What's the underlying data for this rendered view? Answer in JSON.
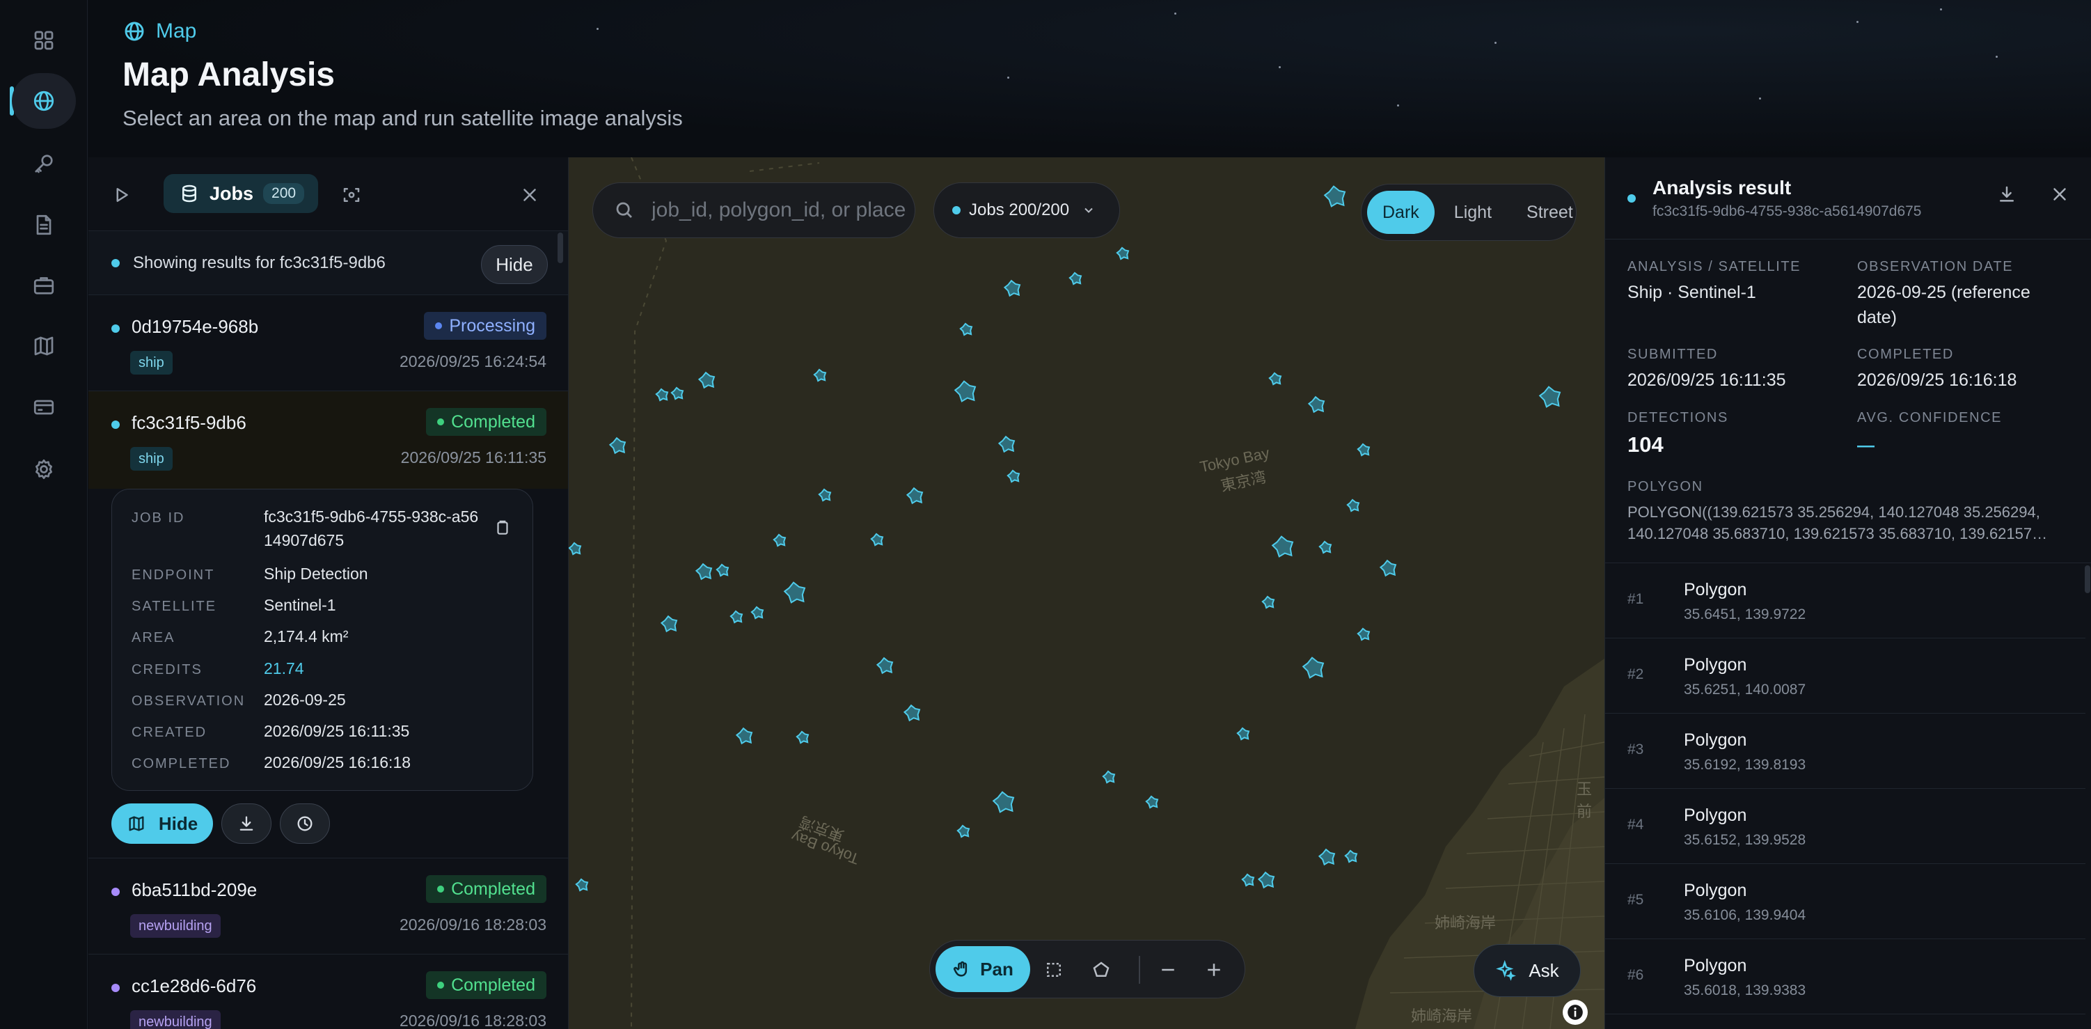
{
  "header": {
    "breadcrumb": "Map",
    "title": "Map Analysis",
    "subtitle": "Select an area on the map and run satellite image analysis"
  },
  "sidebar": {
    "items": [
      {
        "icon": "grid-icon",
        "active": false
      },
      {
        "icon": "globe-icon",
        "active": true
      },
      {
        "icon": "key-icon",
        "active": false
      },
      {
        "icon": "document-icon",
        "active": false
      },
      {
        "icon": "briefcase-icon",
        "active": false
      },
      {
        "icon": "map-icon",
        "active": false
      },
      {
        "icon": "credit-card-icon",
        "active": false
      },
      {
        "icon": "gear-icon",
        "active": false
      }
    ]
  },
  "jobs_panel": {
    "tab_label": "Jobs",
    "tab_count": "200",
    "showing_text": "Showing results for fc3c31f5-9db6",
    "hide_label": "Hide",
    "jobs": [
      {
        "id": "0d19754e-968b",
        "tag": "ship",
        "status": "Processing",
        "date": "2026/09/25 16:24:54"
      },
      {
        "id": "fc3c31f5-9db6",
        "tag": "ship",
        "status": "Completed",
        "date": "2026/09/25 16:11:35"
      },
      {
        "id": "6ba511bd-209e",
        "tag": "newbuilding",
        "status": "Completed",
        "date": "2026/09/16 18:28:03"
      },
      {
        "id": "cc1e28d6-6d76",
        "tag": "newbuilding",
        "status": "Completed",
        "date": "2026/09/16 18:28:03"
      }
    ],
    "detail": {
      "job_id_label": "JOB ID",
      "job_id": "fc3c31f5-9db6-4755-938c-a5614907d675",
      "endpoint_label": "ENDPOINT",
      "endpoint": "Ship Detection",
      "satellite_label": "SATELLITE",
      "satellite": "Sentinel-1",
      "area_label": "AREA",
      "area": "2,174.4 km²",
      "credits_label": "CREDITS",
      "credits": "21.74",
      "observation_label": "OBSERVATION",
      "observation": "2026-09-25",
      "created_label": "CREATED",
      "created": "2026/09/25 16:11:35",
      "completed_label": "COMPLETED",
      "completed": "2026/09/25 16:16:18"
    },
    "hide_button": "Hide"
  },
  "map": {
    "search_placeholder": "job_id, polygon_id, or place",
    "jobs_filter": "Jobs 200/200",
    "styles": [
      "Dark",
      "Light",
      "Street"
    ],
    "active_style": "Dark",
    "pan_label": "Pan",
    "ask_label": "Ask",
    "labels": {
      "tokyo_bay_en": "Tokyo Bay",
      "tokyo_bay_ja": "東京湾",
      "anegasaki_1": "姉崎海岸",
      "anegasaki_2": "姉崎海岸",
      "tamaura": "玉前",
      "tokyo_bay_mirror_ja": "東京湾",
      "tokyo_bay_mirror_en": "Tokyo Bay"
    },
    "colors": {
      "accent": "#4fcbea",
      "land": "#2b2a1f",
      "detection": "#4fcbea"
    }
  },
  "result": {
    "title": "Analysis result",
    "job_id": "fc3c31f5-9db6-4755-938c-a5614907d675",
    "analysis_label": "ANALYSIS / SATELLITE",
    "analysis_value": "Ship · Sentinel-1",
    "obs_label": "OBSERVATION DATE",
    "obs_value": "2026-09-25 (reference date)",
    "submitted_label": "SUBMITTED",
    "submitted_value": "2026/09/25 16:11:35",
    "completed_label": "COMPLETED",
    "completed_value": "2026/09/25 16:16:18",
    "detections_label": "DETECTIONS",
    "detections_value": "104",
    "confidence_label": "AVG. CONFIDENCE",
    "confidence_value": "—",
    "polygon_label": "POLYGON",
    "polygon_value": "POLYGON((139.621573 35.256294, 140.127048 35.256294, 140.127048 35.683710, 139.621573 35.683710, 139.62157…",
    "polygons": [
      {
        "num": "#1",
        "title": "Polygon",
        "coords": "35.6451, 139.9722"
      },
      {
        "num": "#2",
        "title": "Polygon",
        "coords": "35.6251, 140.0087"
      },
      {
        "num": "#3",
        "title": "Polygon",
        "coords": "35.6192, 139.8193"
      },
      {
        "num": "#4",
        "title": "Polygon",
        "coords": "35.6152, 139.9528"
      },
      {
        "num": "#5",
        "title": "Polygon",
        "coords": "35.6106, 139.9404"
      },
      {
        "num": "#6",
        "title": "Polygon",
        "coords": "35.6018, 139.9383"
      }
    ]
  }
}
